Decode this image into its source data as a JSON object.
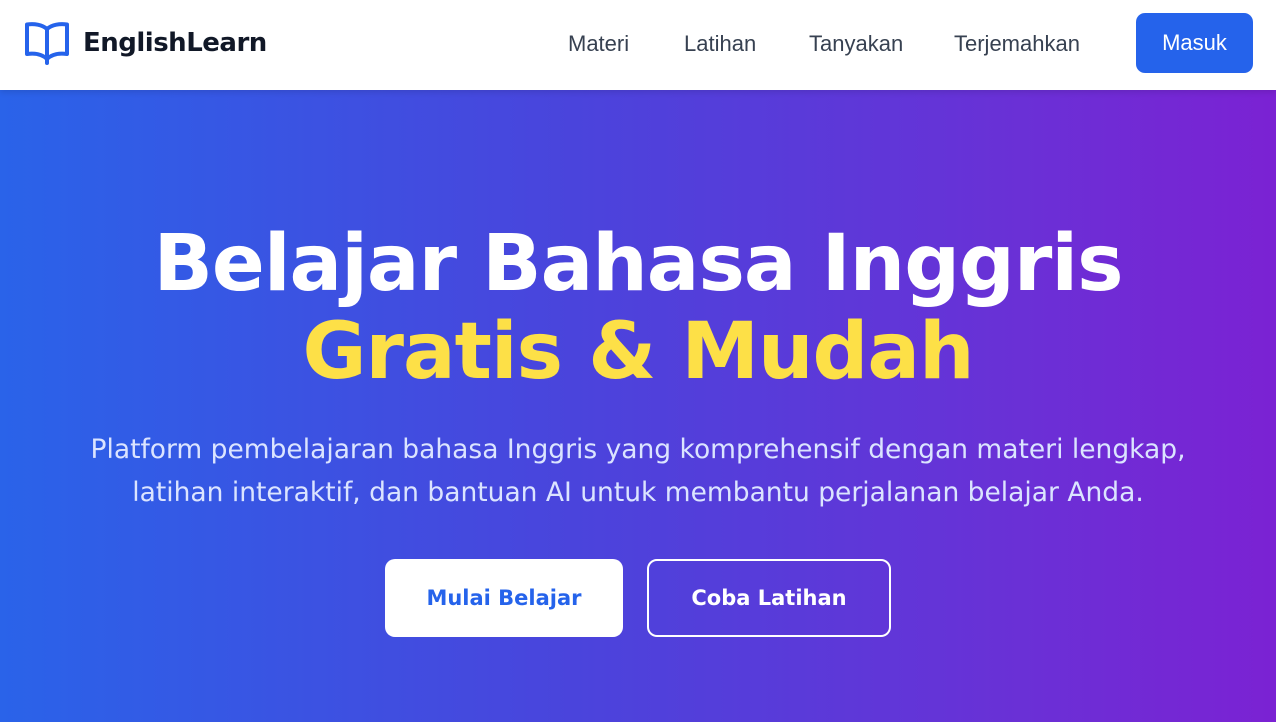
{
  "brand": {
    "icon": "open-book-icon",
    "name": "EnglishLearn",
    "color": "#2563eb"
  },
  "nav": {
    "items": [
      {
        "label": "Materi"
      },
      {
        "label": "Latihan"
      },
      {
        "label": "Tanyakan"
      },
      {
        "label": "Terjemahkan"
      }
    ],
    "login_label": "Masuk"
  },
  "hero": {
    "title_line1": "Belajar Bahasa Inggris",
    "title_line2": "Gratis & Mudah",
    "subtitle_line1": "Platform pembelajaran bahasa Inggris yang komprehensif dengan materi lengkap,",
    "subtitle_line2": "latihan interaktif, dan bantuan AI untuk membantu perjalanan belajar Anda.",
    "primary_button": "Mulai Belajar",
    "secondary_button": "Coba Latihan"
  },
  "colors": {
    "accent": "#2563eb",
    "highlight": "#fde047",
    "gradient_start": "#2a63e9",
    "gradient_end": "#7b22d3"
  }
}
